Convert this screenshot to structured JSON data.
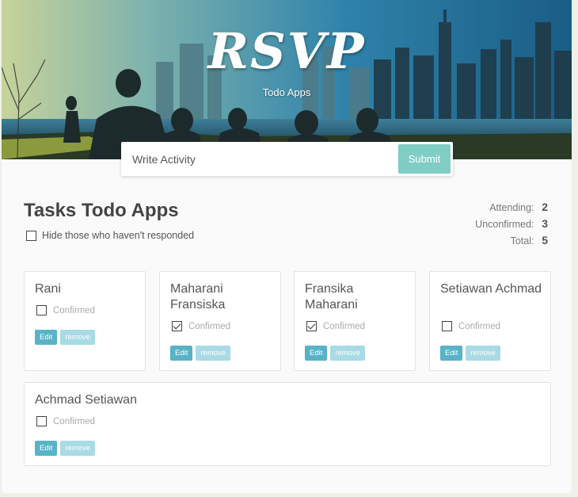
{
  "header": {
    "logo": "RSVP",
    "subtitle": "Todo Apps"
  },
  "form": {
    "placeholder": "Write Activity",
    "submit_label": "Submit"
  },
  "main": {
    "heading": "Tasks Todo Apps",
    "hide_label": "Hide those who haven't responded",
    "hide_checked": false
  },
  "counter": {
    "attending_label": "Attending:",
    "attending": "2",
    "unconfirmed_label": "Unconfirmed:",
    "unconfirmed": "3",
    "total_label": "Total:",
    "total": "5"
  },
  "guests": [
    {
      "name": "Rani",
      "confirmed": false
    },
    {
      "name": "Maharani Fransiska",
      "confirmed": true
    },
    {
      "name": "Fransika Maharani",
      "confirmed": true
    },
    {
      "name": "Setiawan Achmad",
      "confirmed": false
    },
    {
      "name": "Achmad Setiawan",
      "confirmed": false
    }
  ],
  "card_labels": {
    "confirmed": "Confirmed",
    "edit": "Edit",
    "remove": "remove"
  },
  "colors": {
    "accent_teal": "#80cdc4",
    "edit_button": "#58b3c7",
    "remove_button": "#a8dbe4"
  }
}
